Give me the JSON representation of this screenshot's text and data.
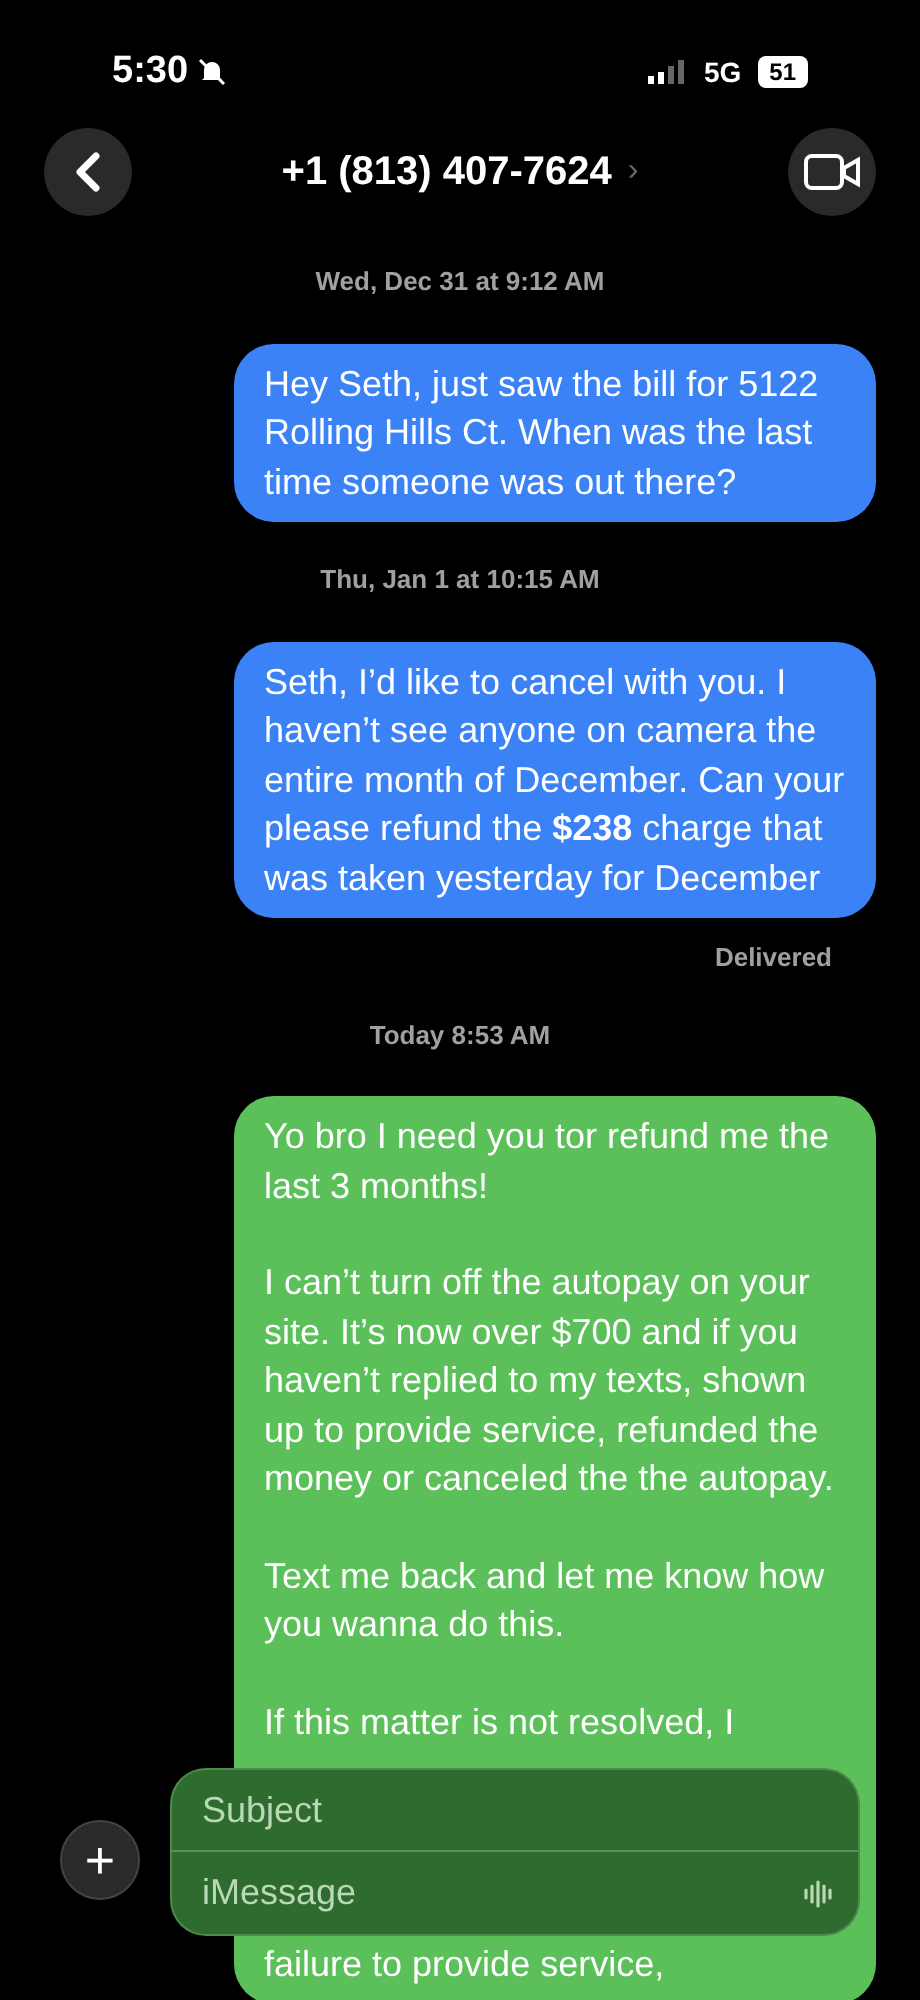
{
  "status_bar": {
    "time": "5:30",
    "network": "5G",
    "battery": "51",
    "silenced": true
  },
  "header": {
    "contact": "+1 (813) 407-7624",
    "chevron": "›"
  },
  "messages": [
    {
      "kind": "timestamp",
      "text": "Wed, Dec 31 at 9:12 AM"
    },
    {
      "kind": "sent",
      "color": "#3b82f6",
      "paragraphs": [
        "Hey Seth, just saw the bill for 5122 Rolling Hills Ct. When was the last time someone was out there?"
      ]
    },
    {
      "kind": "timestamp",
      "text": "Thu, Jan 1 at 10:15 AM"
    },
    {
      "kind": "sent",
      "color": "#3b82f6",
      "paragraphs": [
        "Seth, I’d like to cancel with you. I haven’t see anyone on camera the entire month of December. Can your please refund the **$238** charge that was taken yesterday for December"
      ]
    },
    {
      "kind": "status",
      "text": "Delivered"
    },
    {
      "kind": "timestamp",
      "text": "Today 8:53 AM"
    },
    {
      "kind": "sent",
      "color": "#5cc05a",
      "paragraphs": [
        "Yo bro I need you tor refund me the last 3 months!",
        "I can’t turn off the autopay on your site. It’s now over $700 and if you haven’t replied to my texts, shown up to provide service, refunded the money or canceled the the autopay.",
        "Text me back and let me know how you wanna do this.",
        "If this matter is not resolved, I"
      ],
      "tail": "failure to provide service,"
    }
  ],
  "composer": {
    "subject_placeholder": "Subject",
    "message_placeholder": "iMessage",
    "plus": "+"
  }
}
